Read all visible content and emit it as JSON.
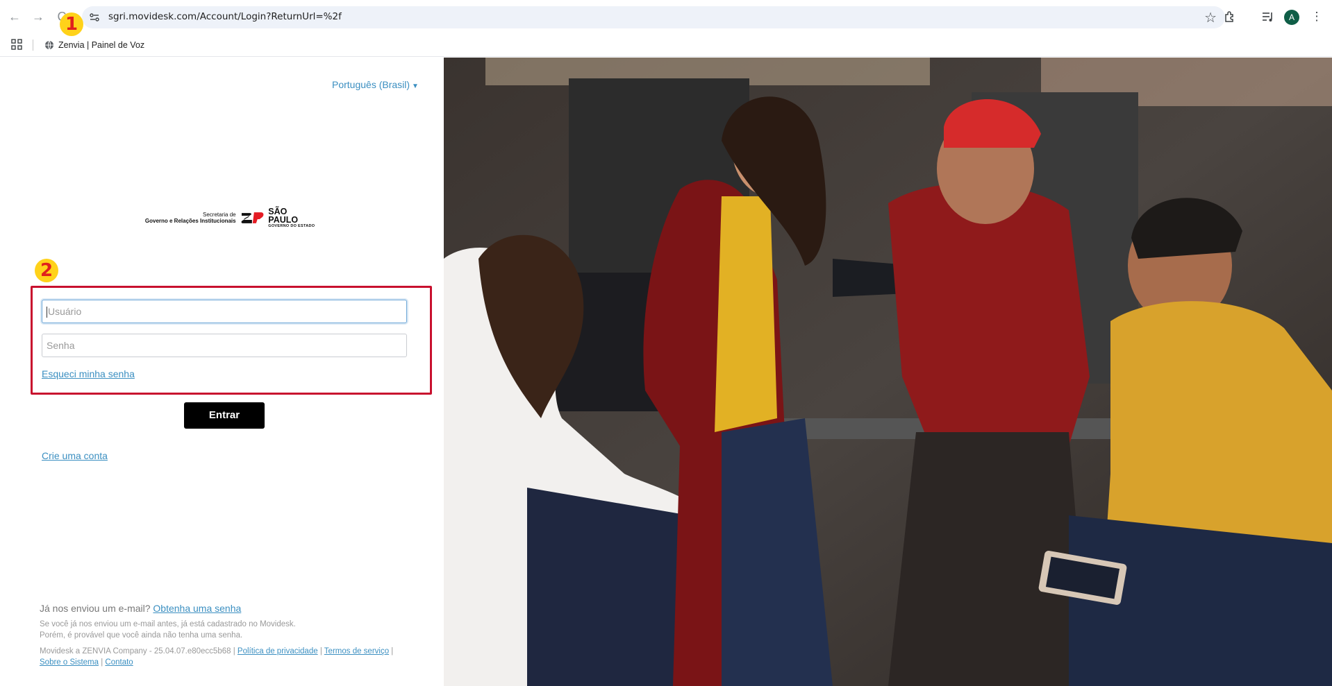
{
  "browser": {
    "url": "sgri.movidesk.com/Account/Login?ReturnUrl=%2f",
    "avatar_letter": "A",
    "bookmark": "Zenvia | Painel de Voz"
  },
  "markers": {
    "one": "1",
    "two": "2"
  },
  "login": {
    "language": "Português (Brasil)",
    "logo": {
      "line1": "Secretaria de",
      "line2": "Governo e Relações Institucionais",
      "state": "SÃO PAULO",
      "state_sub": "GOVERNO DO ESTADO"
    },
    "username_placeholder": "Usuário",
    "password_placeholder": "Senha",
    "forgot_password": "Esqueci minha senha",
    "enter_button": "Entrar",
    "create_account": "Crie uma conta"
  },
  "footer": {
    "question": "Já nos enviou um e-mail?",
    "get_password": "Obtenha uma senha",
    "note_line1": "Se você já nos enviou um e-mail antes, já está cadastrado no Movidesk.",
    "note_line2": "Porém, é provável que você ainda não tenha uma senha.",
    "company": "Movidesk a ZENVIA Company - 25.04.07.e80ecc5b68 |",
    "privacy": "Política de privacidade",
    "terms": "Termos de serviço",
    "about": "Sobre o Sistema",
    "contact": "Contato"
  },
  "colors": {
    "accent": "#3b8fc1",
    "highlight": "#c8102e",
    "marker": "#ffd21a"
  }
}
